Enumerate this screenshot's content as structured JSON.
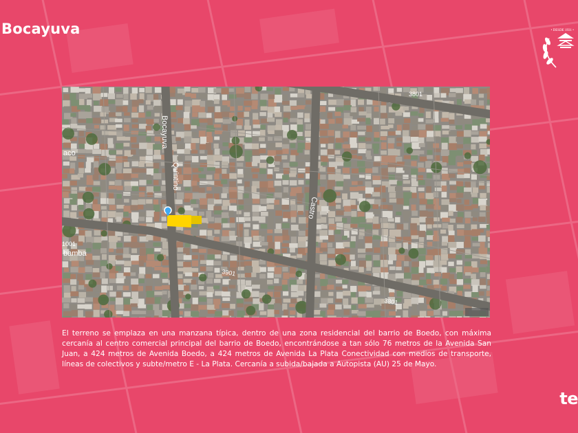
{
  "page": {
    "title": "Bocayuva"
  },
  "logo": {
    "motto": "• DESDE 1931 •"
  },
  "map": {
    "street_labels": {
      "bocayuva": "Bocayuva",
      "quintino": "Quintino",
      "castro": "Castro",
      "house_3801_top": "3801",
      "house_3901": "3901",
      "house_3801_bottom": "3801",
      "house_1001": "1001",
      "bamba": "bamba",
      "aco": "aco"
    },
    "lot_marker_color": "#ffd400",
    "pin_color": "#3fa9f5"
  },
  "description": "El terreno se emplaza en una manzana típica, dentro de una zona residencial del barrio de Boedo, con máxima cercanía al centro comercial principal del barrio de Boedo, encontrándose a tan sólo 76 metros de la Avenida San Juan, a 424 metros de Avenida Boedo, a 424 metros de Avenida La Plata Conectividad con medios de transporte, líneas de colectivos y subte/metro E - La Plata. Cercanía a subida/bajada a Autopista (AU) 25 de Mayo.",
  "brand": {
    "label": "te"
  },
  "colors": {
    "background": "#e8476a",
    "text": "#ffffff"
  }
}
